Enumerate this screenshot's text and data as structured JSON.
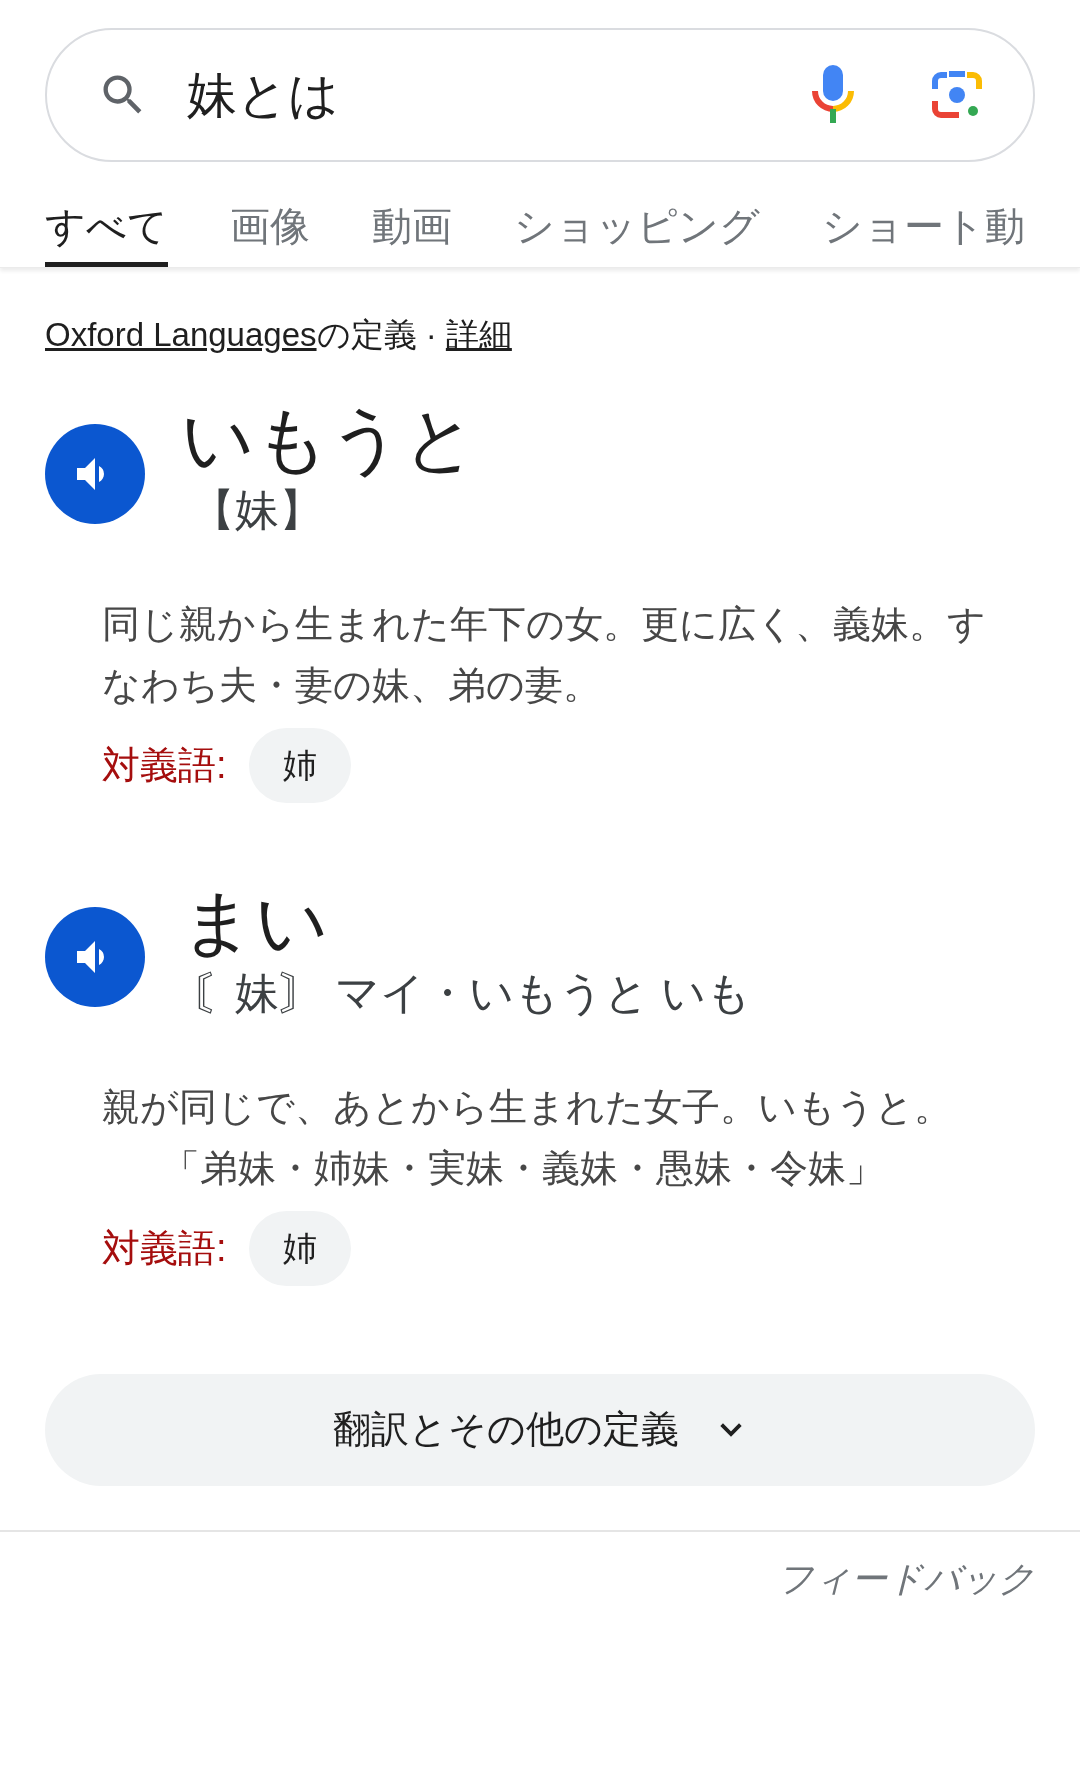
{
  "search": {
    "value": "妹とは"
  },
  "tabs": [
    {
      "label": "すべて",
      "selected": true
    },
    {
      "label": "画像",
      "selected": false
    },
    {
      "label": "動画",
      "selected": false
    },
    {
      "label": "ショッピング",
      "selected": false
    },
    {
      "label": "ショート動",
      "selected": false
    }
  ],
  "source": {
    "link": "Oxford Languages",
    "suffix": "の定義 · ",
    "details": "詳細"
  },
  "entries": [
    {
      "headword": "いもうと",
      "reading": "【妹】",
      "definition": "同じ親から生まれた年下の女。更に広く、義妹。すなわち夫・妻の妹、弟の妻。",
      "antonym_label": "対義語:",
      "antonym": "姉"
    },
    {
      "headword": "まい",
      "reading": "〘妹〙 マイ・いもうと いも",
      "definition": "親が同じで、あとから生まれた女子。いもうと。",
      "example": "「弟妹・姉妹・実妹・義妹・愚妹・令妹」",
      "antonym_label": "対義語:",
      "antonym": "姉"
    }
  ],
  "more_button": "翻訳とその他の定義",
  "feedback": "フィードバック"
}
